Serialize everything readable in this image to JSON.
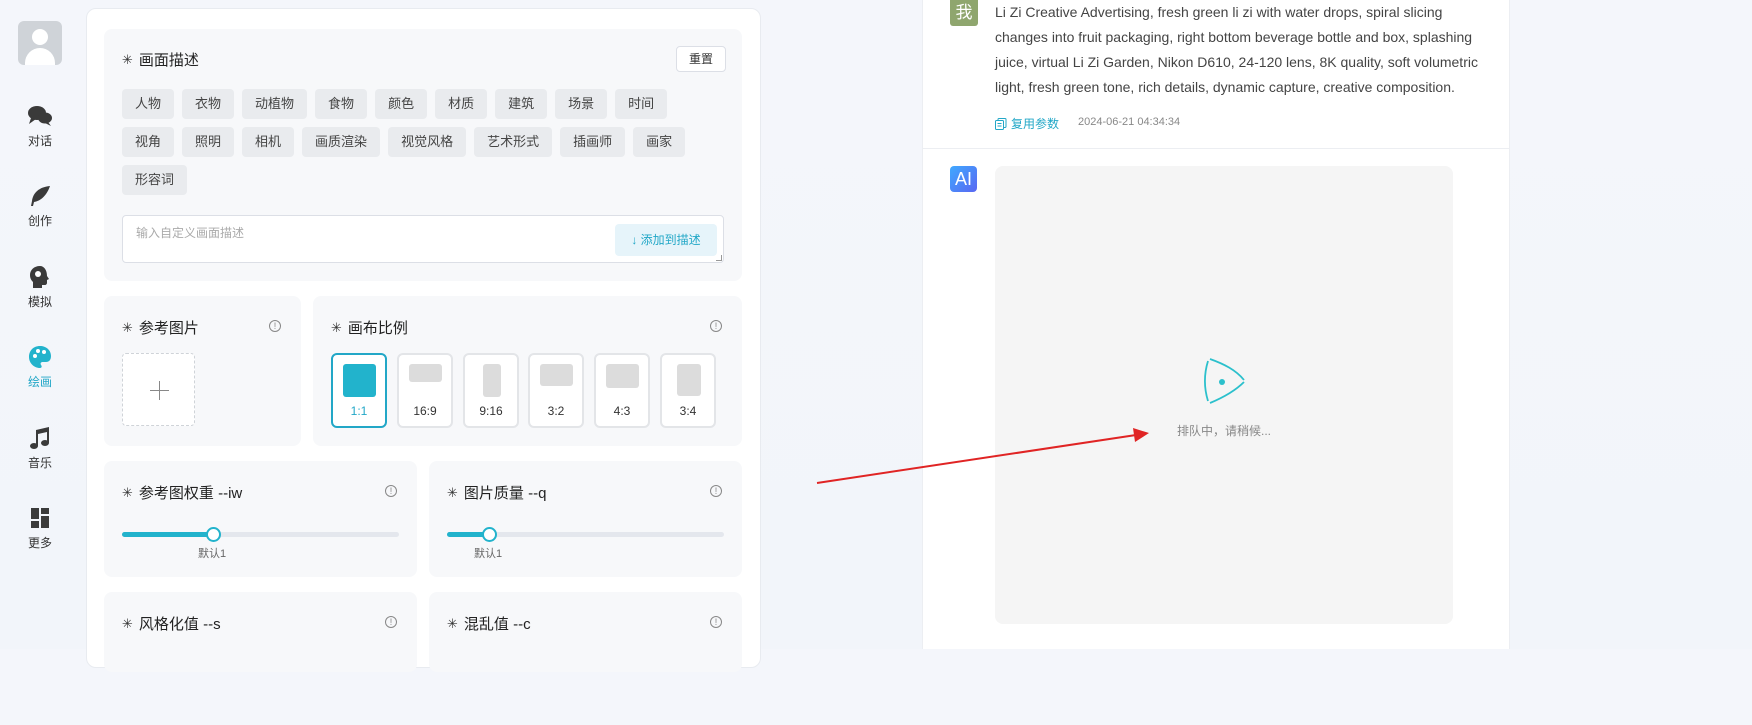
{
  "nav": {
    "items": [
      {
        "label": "对话",
        "icon": "chat-bubbles-icon"
      },
      {
        "label": "创作",
        "icon": "feather-icon"
      },
      {
        "label": "模拟",
        "icon": "head-profile-icon"
      },
      {
        "label": "绘画",
        "icon": "palette-icon",
        "active": true
      },
      {
        "label": "音乐",
        "icon": "music-note-icon"
      },
      {
        "label": "更多",
        "icon": "grid-icon"
      }
    ]
  },
  "prompt_section": {
    "title": "画面描述",
    "reset_label": "重置",
    "tags": [
      "人物",
      "衣物",
      "动植物",
      "食物",
      "颜色",
      "材质",
      "建筑",
      "场景",
      "时间",
      "视角",
      "照明",
      "相机",
      "画质渲染",
      "视觉风格",
      "艺术形式",
      "插画师",
      "画家",
      "形容词"
    ],
    "input_placeholder": "输入自定义画面描述",
    "add_button_label": "↓ 添加到描述"
  },
  "reference_image": {
    "title": "参考图片"
  },
  "aspect_ratio": {
    "title": "画布比例",
    "options": [
      "1:1",
      "16:9",
      "9:16",
      "3:2",
      "4:3",
      "3:4"
    ],
    "selected": "1:1"
  },
  "image_weight": {
    "title": "参考图权重 --iw",
    "note": "默认1",
    "value_fraction": 0.33
  },
  "image_quality": {
    "title": "图片质量 --q",
    "note": "默认1",
    "value_fraction": 0.15
  },
  "stylize": {
    "title": "风格化值 --s"
  },
  "chaos": {
    "title": "混乱值 --c"
  },
  "chat": {
    "user_badge": "我",
    "user_prompt": "Li Zi Creative Advertising, fresh green li zi with water drops, spiral slicing changes into fruit packaging, right bottom beverage bottle and box, splashing juice, virtual Li Zi Garden, Nikon D610, 24-120 lens, 8K quality, soft volumetric light, fresh green tone, rich details, dynamic capture, creative composition.",
    "reuse_label": "复用参数",
    "timestamp": "2024-06-21 04:34:34",
    "ai_badge": "AI",
    "queue_status": "排队中，请稍候..."
  },
  "colors": {
    "accent": "#22b3cc",
    "annotation_arrow": "#e02424"
  }
}
